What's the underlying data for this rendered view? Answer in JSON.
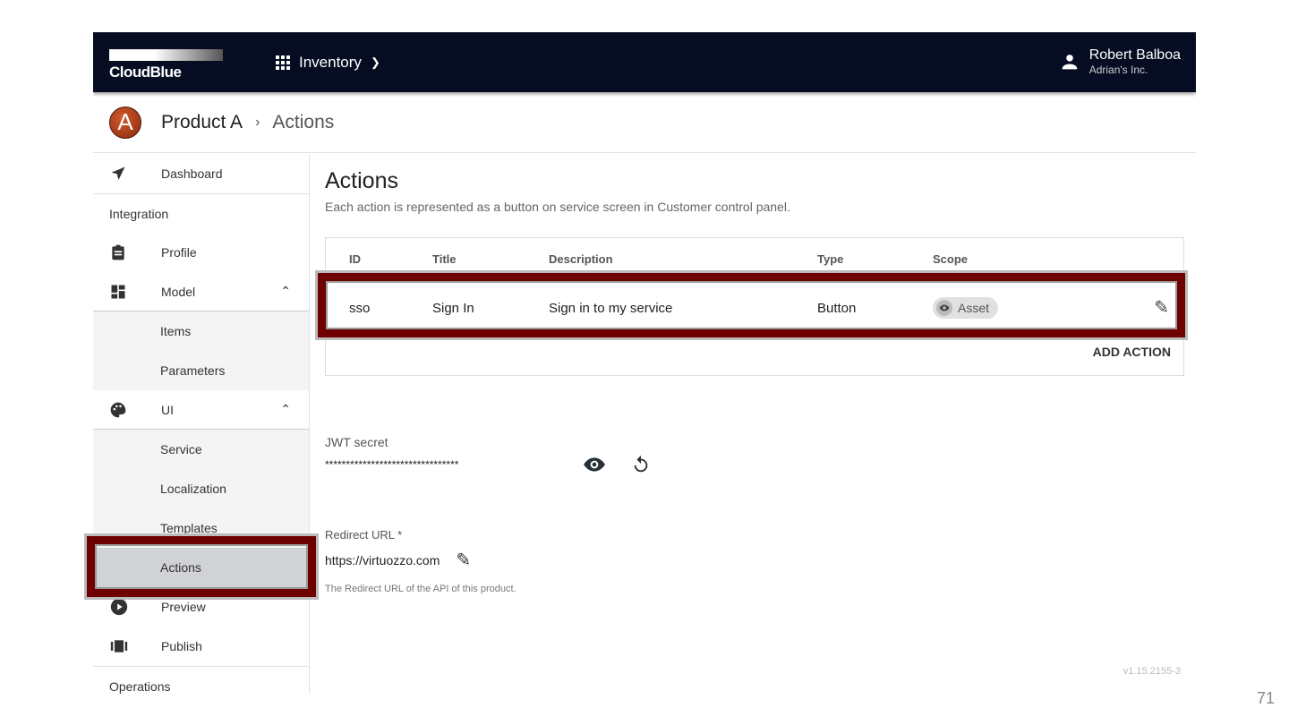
{
  "header": {
    "logo": "CloudBlue",
    "app": "Inventory",
    "user_name": "Robert Balboa",
    "user_org": "Adrian's Inc."
  },
  "breadcrumb": {
    "avatar_letter": "A",
    "product": "Product A",
    "separator": "›",
    "current": "Actions"
  },
  "sidebar": {
    "items": [
      {
        "label": "Dashboard",
        "type": "item",
        "icon": "navigation-icon"
      },
      {
        "label": "Integration",
        "type": "section"
      },
      {
        "label": "Profile",
        "type": "item",
        "icon": "clipboard-icon"
      },
      {
        "label": "Model",
        "type": "item",
        "icon": "dashboard-icon",
        "chevron": "^"
      },
      {
        "label": "Items",
        "type": "sub"
      },
      {
        "label": "Parameters",
        "type": "sub"
      },
      {
        "label": "UI",
        "type": "item",
        "icon": "palette-icon",
        "chevron": "^"
      },
      {
        "label": "Service",
        "type": "sub"
      },
      {
        "label": "Localization",
        "type": "sub"
      },
      {
        "label": "Templates",
        "type": "sub"
      },
      {
        "label": "Actions",
        "type": "sub",
        "selected": true
      },
      {
        "label": "Preview",
        "type": "item",
        "icon": "play-circle-icon"
      },
      {
        "label": "Publish",
        "type": "item",
        "icon": "view-carousel-icon"
      },
      {
        "label": "Operations",
        "type": "section"
      }
    ]
  },
  "main": {
    "title": "Actions",
    "description": "Each action is represented as a button on service screen in Customer control panel.",
    "table": {
      "headers": [
        "ID",
        "Title",
        "Description",
        "Type",
        "Scope"
      ],
      "rows": [
        {
          "id": "sso",
          "title": "Sign In",
          "description": "Sign in to my service",
          "type": "Button",
          "scope": "Asset"
        }
      ],
      "add_label": "ADD ACTION"
    },
    "jwt": {
      "label": "JWT secret",
      "value": "********************************"
    },
    "redirect": {
      "label": "Redirect URL *",
      "value": "https://virtuozzo.com",
      "hint": "The Redirect URL of the API of this product."
    },
    "version": "v1.15.2155-3"
  },
  "page_number": "71",
  "colors": {
    "header": "#060d22",
    "highlight": "#6e0000"
  }
}
